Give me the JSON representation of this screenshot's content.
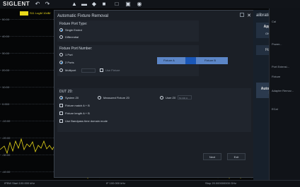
{
  "app": {
    "brand": "SIGLENT"
  },
  "trace": {
    "label": "S11 LogM 10dB/"
  },
  "y_axis": {
    "labels": [
      "50.00",
      "40.00",
      "30.00",
      "20.00",
      "10.00",
      "0.000",
      "-10.00",
      "-20.00",
      "-30.00",
      "-40.00",
      "-50.00"
    ]
  },
  "dialog": {
    "title": "Automatic Fixture Removal",
    "fixture_port_type": {
      "label": "Fixture Port Type:",
      "options": [
        "Single Ended",
        "Differential"
      ],
      "selected": "Single Ended"
    },
    "fixture_port_number": {
      "label": "Fixture Port Number:",
      "options": [
        "1 Port",
        "2 Ports",
        "Multiport"
      ],
      "selected": "2 Ports",
      "use_fixture_label": "Use Fixture"
    },
    "fixture_bar": {
      "left_label": "Fixture A",
      "right_label": "Fixture B"
    },
    "dut_zo": {
      "label": "DUT Z0:",
      "options": [
        "System Z0",
        "Measured Fixture Z0",
        "User Z0"
      ],
      "selected": "System Z0",
      "user_z0_placeholder": "50.000 Ω"
    },
    "checks": [
      "Fixture match A + B",
      "Fixture length A + B",
      "Use Bandpass time domain mode"
    ],
    "buttons": {
      "next": "Next",
      "exit": "Exit"
    }
  },
  "calibration": {
    "title": "alibration",
    "apply_fixtures_label": "Apply Fixtures",
    "on": "ON",
    "off": "Off",
    "fixture_setup": "Fixture Setup",
    "auto_fixture_removal": "Automatic Fixture Removal"
  },
  "right_panel": {
    "items": [
      "Cal",
      "Power...",
      "Port Extensi...",
      "Fixture",
      "Adapter Remov...",
      "ECal"
    ]
  },
  "bottom": {
    "left": "IFBW  Start 100.000 kHz",
    "mid": "IF 100.000 kHz",
    "right": "Stop 20.000000000 GHz"
  }
}
